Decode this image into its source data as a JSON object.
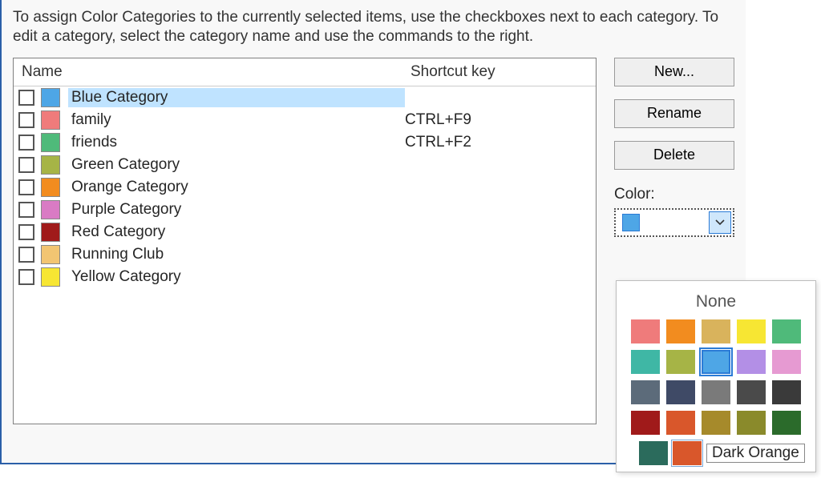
{
  "instruction": "To assign Color Categories to the currently selected items, use the checkboxes next to each category.  To edit a category, select the category name and use the commands to the right.",
  "columns": {
    "name": "Name",
    "shortcut": "Shortcut key"
  },
  "categories": [
    {
      "label": "Blue Category",
      "color": "#4ea6e6",
      "shortcut": "",
      "selected": true
    },
    {
      "label": "family",
      "color": "#ef7b7b",
      "shortcut": "CTRL+F9",
      "selected": false
    },
    {
      "label": "friends",
      "color": "#4fba7a",
      "shortcut": "CTRL+F2",
      "selected": false
    },
    {
      "label": "Green Category",
      "color": "#a6b446",
      "shortcut": "",
      "selected": false
    },
    {
      "label": "Orange Category",
      "color": "#f28c1f",
      "shortcut": "",
      "selected": false
    },
    {
      "label": "Purple Category",
      "color": "#d97bc4",
      "shortcut": "",
      "selected": false
    },
    {
      "label": "Red Category",
      "color": "#a01a1a",
      "shortcut": "",
      "selected": false
    },
    {
      "label": "Running Club",
      "color": "#f2c572",
      "shortcut": "",
      "selected": false
    },
    {
      "label": "Yellow Category",
      "color": "#f7e633",
      "shortcut": "",
      "selected": false
    }
  ],
  "buttons": {
    "new": "New...",
    "rename": "Rename",
    "delete": "Delete"
  },
  "colorSection": {
    "label": "Color:",
    "current": "#4ea6e6"
  },
  "palette": {
    "noneLabel": "None",
    "grid": [
      [
        "#ef7b7b",
        "#f28c1f",
        "#d9b35c",
        "#f7e633",
        "#4fba7a"
      ],
      [
        "#3fb7a5",
        "#a6b446",
        "#4ea6e6",
        "#b38fe6",
        "#e69ad2"
      ],
      [
        "#5c6b7a",
        "#3f4a66",
        "#7a7a7a",
        "#4a4a4a",
        "#3a3a3a"
      ],
      [
        "#a01a1a",
        "#d9572b",
        "#a68a2b",
        "#8a8a2b",
        "#2b6b2b"
      ]
    ],
    "selectedIndex": [
      1,
      2
    ],
    "hoverIndex": [
      3,
      1
    ],
    "extra": {
      "color": "#2b6b5c",
      "hoverCell": "#d9572b"
    },
    "tooltip": "Dark Orange"
  }
}
